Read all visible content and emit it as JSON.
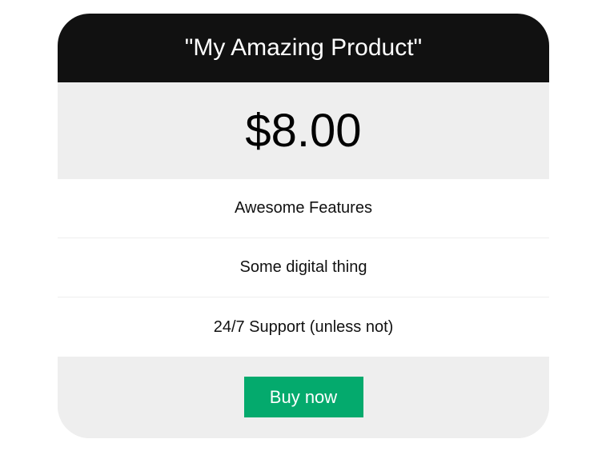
{
  "product": {
    "title": "\"My Amazing Product\"",
    "price": "$8.00"
  },
  "features": [
    "Awesome Features",
    "Some digital thing",
    "24/7 Support (unless not)"
  ],
  "actions": {
    "buy_label": "Buy now"
  },
  "colors": {
    "header_bg": "#111111",
    "panel_bg": "#eeeeee",
    "button_bg": "#04aa6d"
  }
}
